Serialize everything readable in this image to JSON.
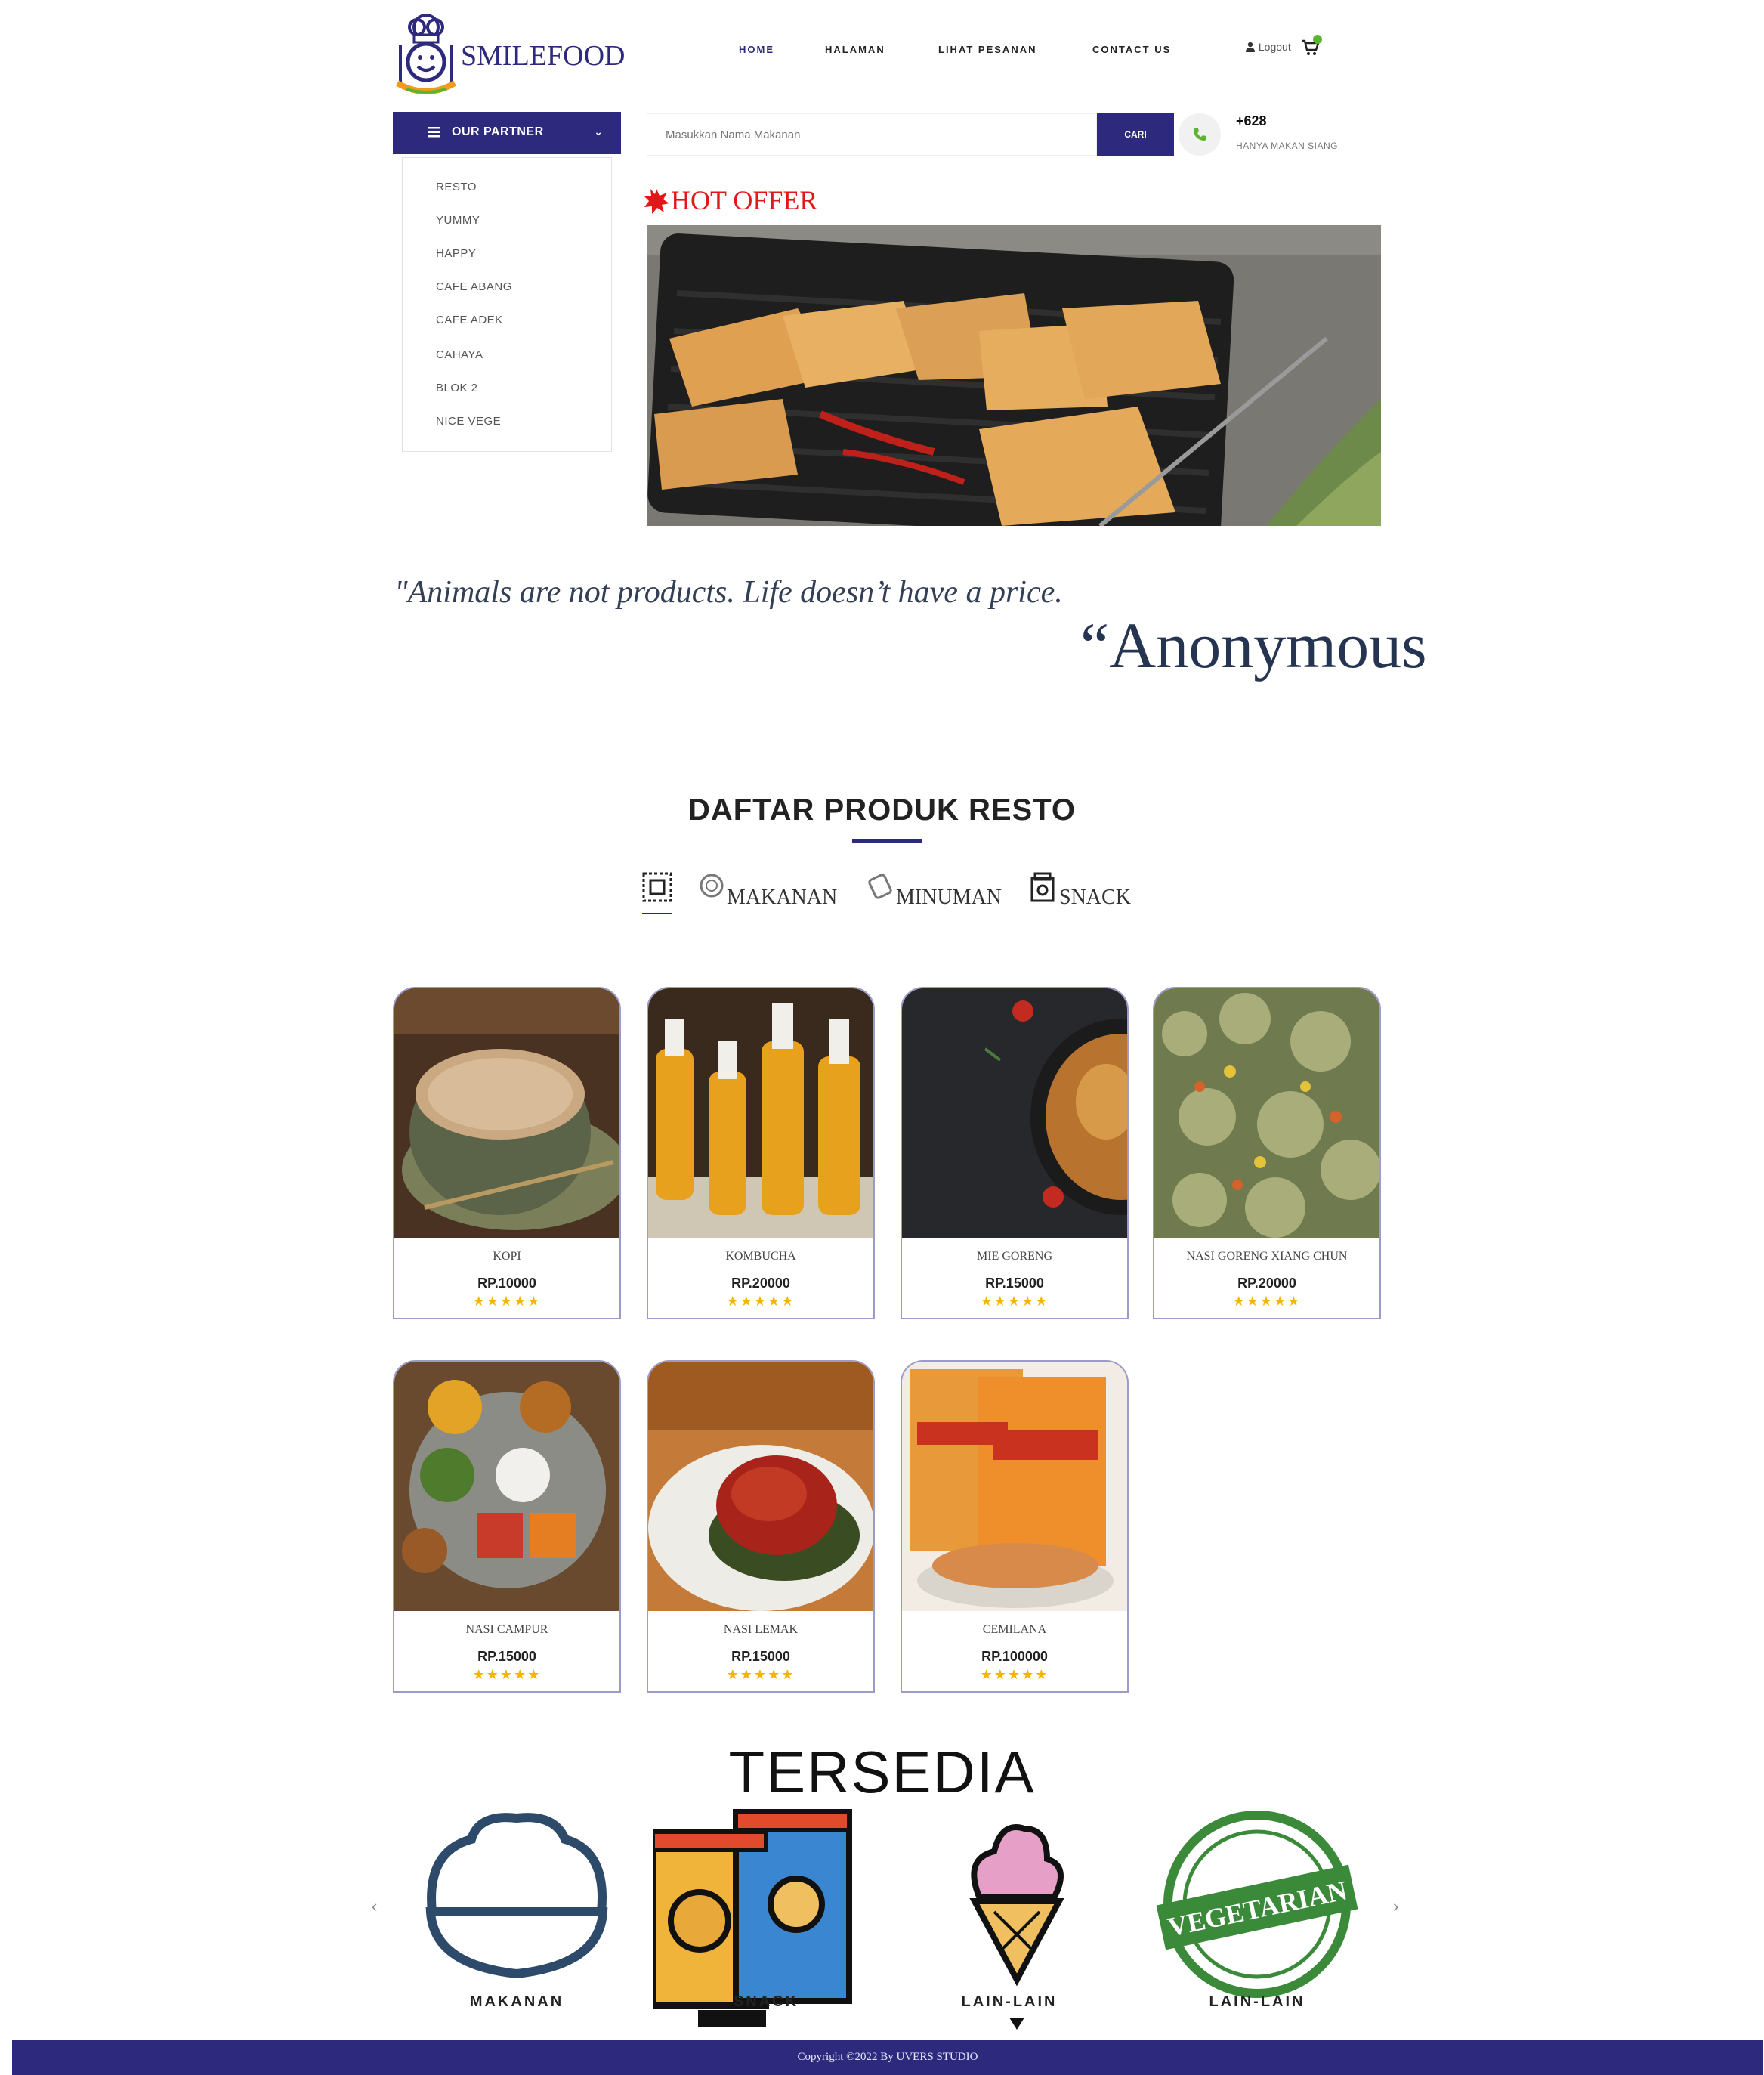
{
  "brand": {
    "name": "SMILEFOOD",
    "tagline": "SMILE FOOD",
    "color": "#2d2a7e"
  },
  "nav": {
    "home": "HOME",
    "halaman": "HALAMAN",
    "lihat_pesanan": "LIHAT PESANAN",
    "contact": "CONTACT US",
    "logout": "Logout"
  },
  "partner": {
    "title": "OUR PARTNER",
    "items": [
      "RESTO",
      "YUMMY",
      "HAPPY",
      "CAFE ABANG",
      "CAFE ADEK",
      "CAHAYA",
      "BLOK 2",
      "NICE VEGE"
    ]
  },
  "search": {
    "placeholder": "Masukkan Nama Makanan",
    "button": "CARI"
  },
  "contact": {
    "phone": "+628",
    "note": "HANYA MAKAN SIANG"
  },
  "hot_offer": {
    "title": "HOT OFFER"
  },
  "quote": {
    "text": "\"Animals are not products. Life doesn’t have a price.",
    "author": "“Anonymous"
  },
  "products": {
    "title": "DAFTAR PRODUK RESTO",
    "tabs": [
      "MAKANAN",
      "MINUMAN",
      "SNACK"
    ],
    "items": [
      {
        "name": "KOPI",
        "price": "RP.10000",
        "stars": "★★★★★"
      },
      {
        "name": "KOMBUCHA",
        "price": "RP.20000",
        "stars": "★★★★★"
      },
      {
        "name": "MIE GORENG",
        "price": "RP.15000",
        "stars": "★★★★★"
      },
      {
        "name": "NASI GORENG XIANG CHUN",
        "price": "RP.20000",
        "stars": "★★★★★"
      },
      {
        "name": "NASI CAMPUR",
        "price": "RP.15000",
        "stars": "★★★★★"
      },
      {
        "name": "NASI LEMAK",
        "price": "RP.15000",
        "stars": "★★★★★"
      },
      {
        "name": "CEMILANA",
        "price": "RP.100000",
        "stars": "★★★★★"
      }
    ]
  },
  "available": {
    "title": "TERSEDIA",
    "items": [
      "MAKANAN",
      "SNACK",
      "LAIN-LAIN",
      "LAIN-LAIN"
    ],
    "badge_text": "VEGETARIAN",
    "prev": "‹",
    "next": "›"
  },
  "footer": {
    "copyright": "Copyright ©2022 By UVERS STUDIO"
  }
}
